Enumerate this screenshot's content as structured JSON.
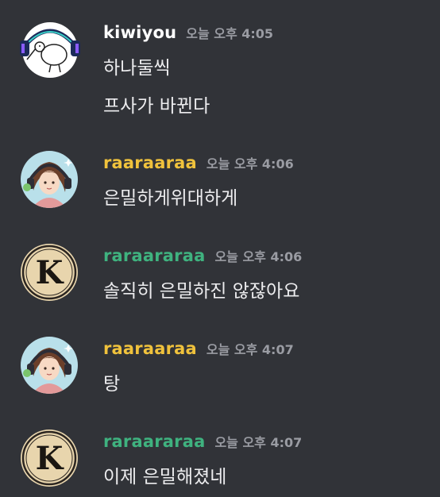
{
  "colors": {
    "background": "#313338",
    "text": "#ececee",
    "timestamp": "#9a9ca3",
    "username_kiwiyou": "#ffffff",
    "username_raaraaraa": "#f0c23c",
    "username_raraararaa": "#3fb27f"
  },
  "messages": [
    {
      "avatar": "kiwi-headphones-avatar",
      "username": "kiwiyou",
      "timestamp": "오늘 오후 4:05",
      "lines": [
        "하나둘씩",
        "프사가 바뀐다"
      ]
    },
    {
      "avatar": "anime-girl-headphones-avatar",
      "username": "raaraaraa",
      "timestamp": "오늘 오후 4:06",
      "lines": [
        "은밀하게위대하게"
      ]
    },
    {
      "avatar": "letter-k-badge-avatar",
      "username": "raraararaa",
      "timestamp": "오늘 오후 4:06",
      "lines": [
        "솔직히 은밀하진 않잖아요"
      ]
    },
    {
      "avatar": "anime-girl-headphones-avatar",
      "username": "raaraaraa",
      "timestamp": "오늘 오후 4:07",
      "lines": [
        "탕"
      ]
    },
    {
      "avatar": "letter-k-badge-avatar",
      "username": "raraararaa",
      "timestamp": "오늘 오후 4:07",
      "lines": [
        "이제 은밀해졌네"
      ]
    }
  ]
}
